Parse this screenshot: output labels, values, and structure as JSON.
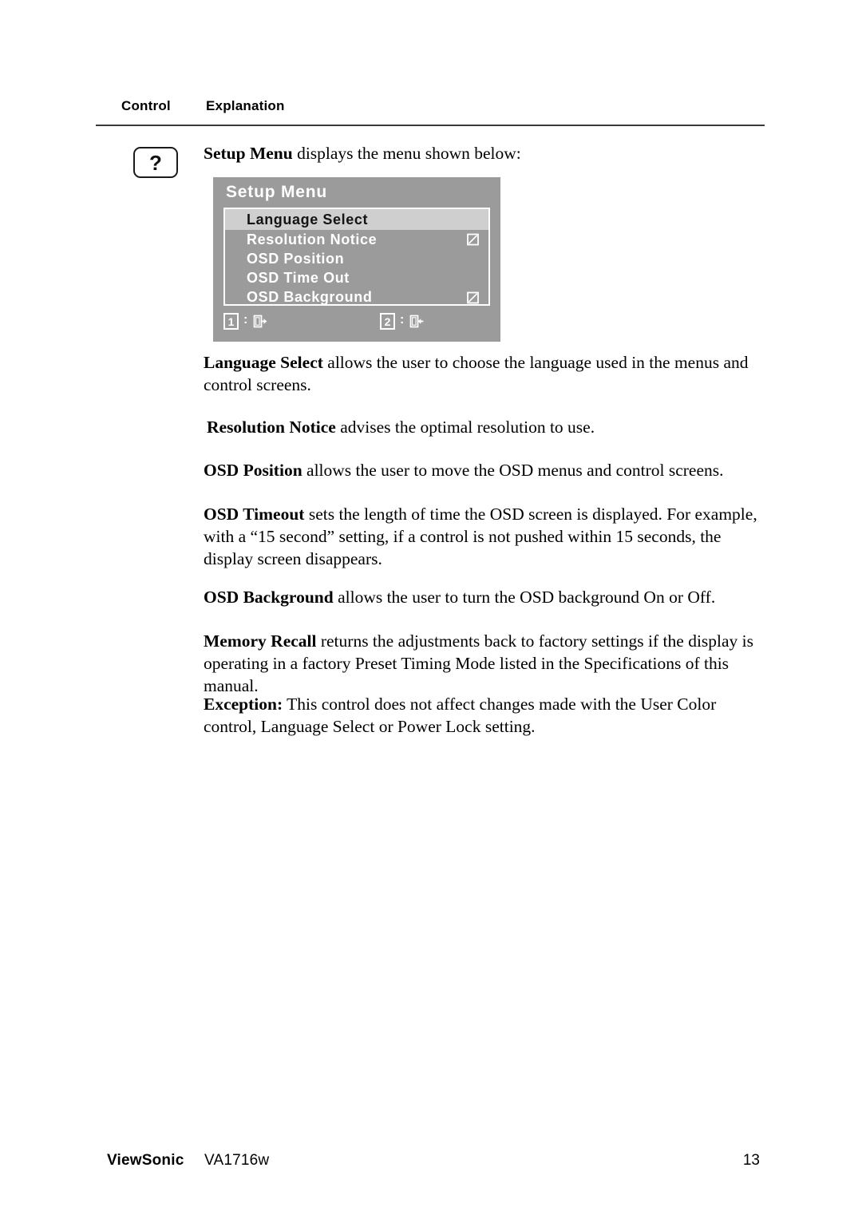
{
  "table_header": {
    "control": "Control",
    "explanation": "Explanation"
  },
  "control_icon": {
    "glyph": "?",
    "name": "question-mark-button"
  },
  "paragraphs": {
    "intro": {
      "lead": "Setup Menu",
      "rest": " displays the menu shown below:"
    },
    "language_select": {
      "lead": "Language Select",
      "rest": " allows the user to choose the language used in the menus and control screens."
    },
    "resolution_notice": {
      "lead": "Resolution Notice",
      "rest": " advises the optimal resolution to use."
    },
    "osd_position": {
      "lead": "OSD Position",
      "rest": " allows the user to move the OSD menus and control screens."
    },
    "osd_timeout": {
      "lead": "OSD Timeout",
      "rest": " sets the length of time the OSD screen is displayed. For example, with a “15 second” setting, if a control is not pushed within 15 seconds, the display screen disappears."
    },
    "osd_background": {
      "lead": "OSD Background",
      "rest": " allows the user to turn the OSD background On or Off."
    },
    "memory_recall": {
      "lead": "Memory Recall",
      "rest": " returns the adjustments back to factory settings if the display is operating in a factory Preset Timing Mode listed in the Specifications of this manual."
    },
    "exception": {
      "lead": "Exception:",
      "rest": " This control does not affect changes made with the User Color control, Language Select or Power Lock setting."
    }
  },
  "osd": {
    "title": "Setup Menu",
    "rows": [
      {
        "label": "Language Select",
        "selected": true,
        "checkbox": false,
        "checked": false
      },
      {
        "label": "Resolution Notice",
        "selected": false,
        "checkbox": true,
        "checked": true
      },
      {
        "label": "OSD Position",
        "selected": false,
        "checkbox": false,
        "checked": false
      },
      {
        "label": "OSD Time Out",
        "selected": false,
        "checkbox": false,
        "checked": false
      },
      {
        "label": "OSD Background",
        "selected": false,
        "checkbox": true,
        "checked": true
      }
    ],
    "footer_keys": [
      {
        "key": "1",
        "separator": ":",
        "icon": "exit-right-icon"
      },
      {
        "key": "2",
        "separator": ":",
        "icon": "enter-left-icon"
      }
    ],
    "colors": {
      "panel_background": "#9b9b9b",
      "selected_row_background": "#cfcfcf",
      "text": "#ffffff",
      "selected_row_text": "#141414",
      "border": "#ffffff"
    }
  },
  "footer": {
    "brand": "ViewSonic",
    "model": "VA1716w",
    "page_number": "13"
  }
}
